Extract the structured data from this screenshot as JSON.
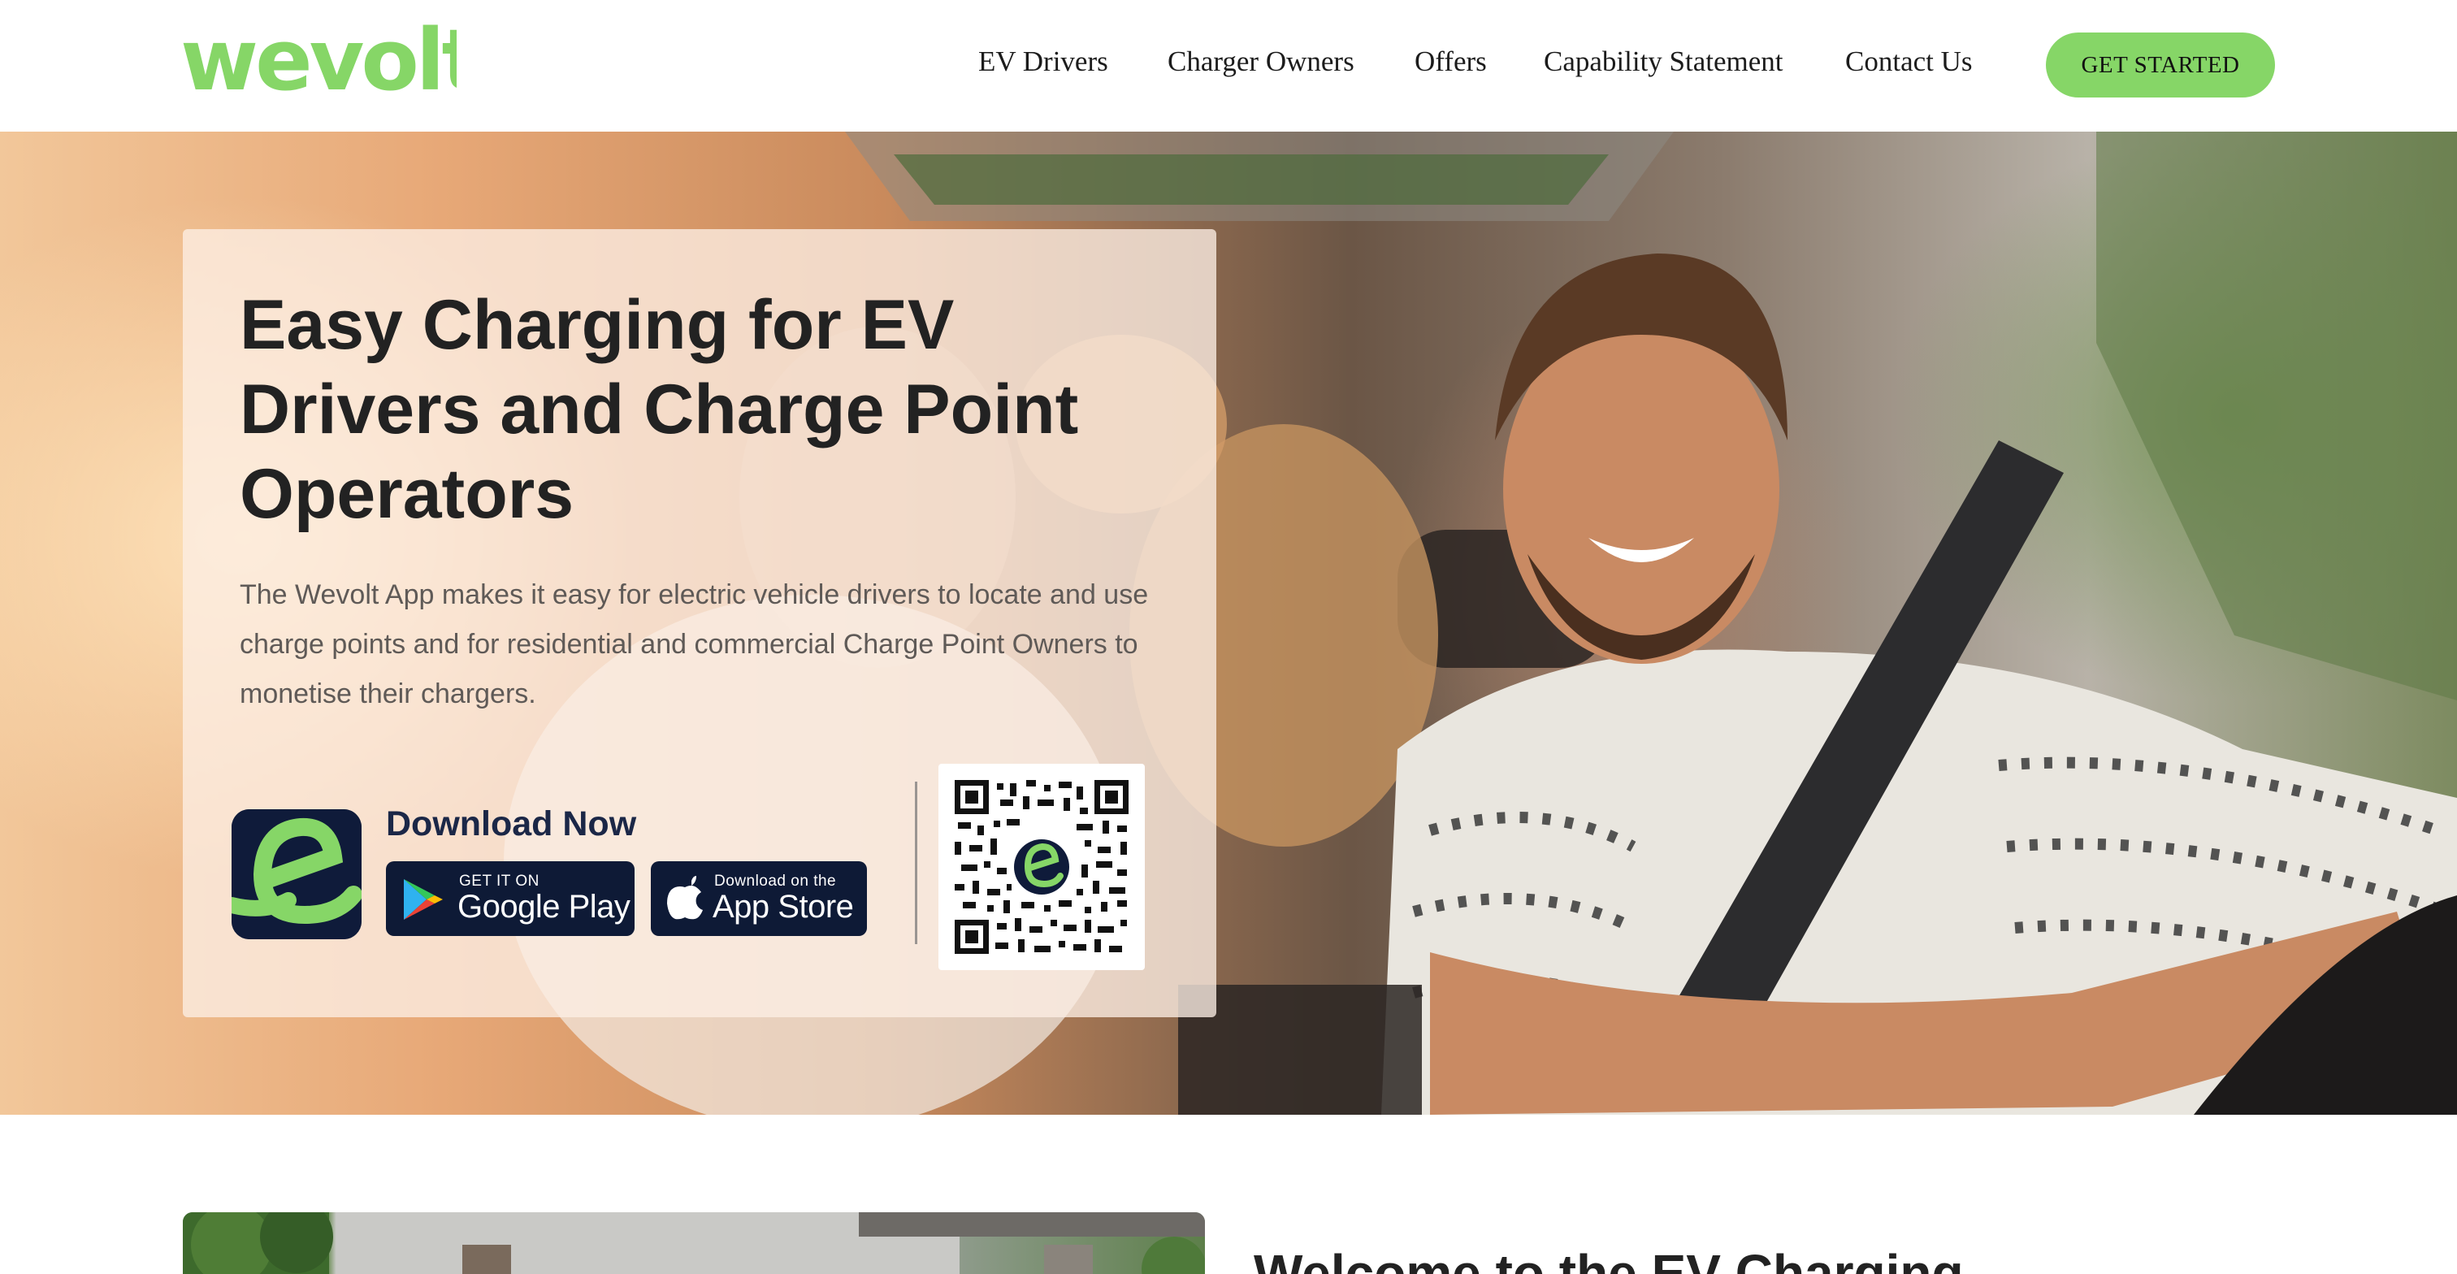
{
  "brand": {
    "logo_text": "wevolt",
    "accent_color": "#86d667",
    "dark_color": "#0e1a36"
  },
  "nav": {
    "items": [
      {
        "label": "EV Drivers"
      },
      {
        "label": "Charger Owners"
      },
      {
        "label": "Offers"
      },
      {
        "label": "Capability Statement"
      },
      {
        "label": "Contact Us"
      }
    ],
    "cta_label": "GET STARTED"
  },
  "hero": {
    "title": "Easy Charging for EV Drivers and Charge Point Operators",
    "description": "The Wevolt App makes it easy for electric vehicle drivers to locate and use charge points and for residential and commercial Charge Point Owners to monetise their chargers.",
    "download_heading": "Download Now",
    "google_play": {
      "small": "GET IT ON",
      "big": "Google Play"
    },
    "app_store": {
      "small": "Download on the",
      "big": "App Store"
    },
    "icons": {
      "app": "wevolt-app-icon",
      "google_play": "google-play-icon",
      "apple": "apple-icon",
      "qr": "qr-code"
    }
  },
  "next_section": {
    "heading": "Welcome to the EV Charging"
  }
}
